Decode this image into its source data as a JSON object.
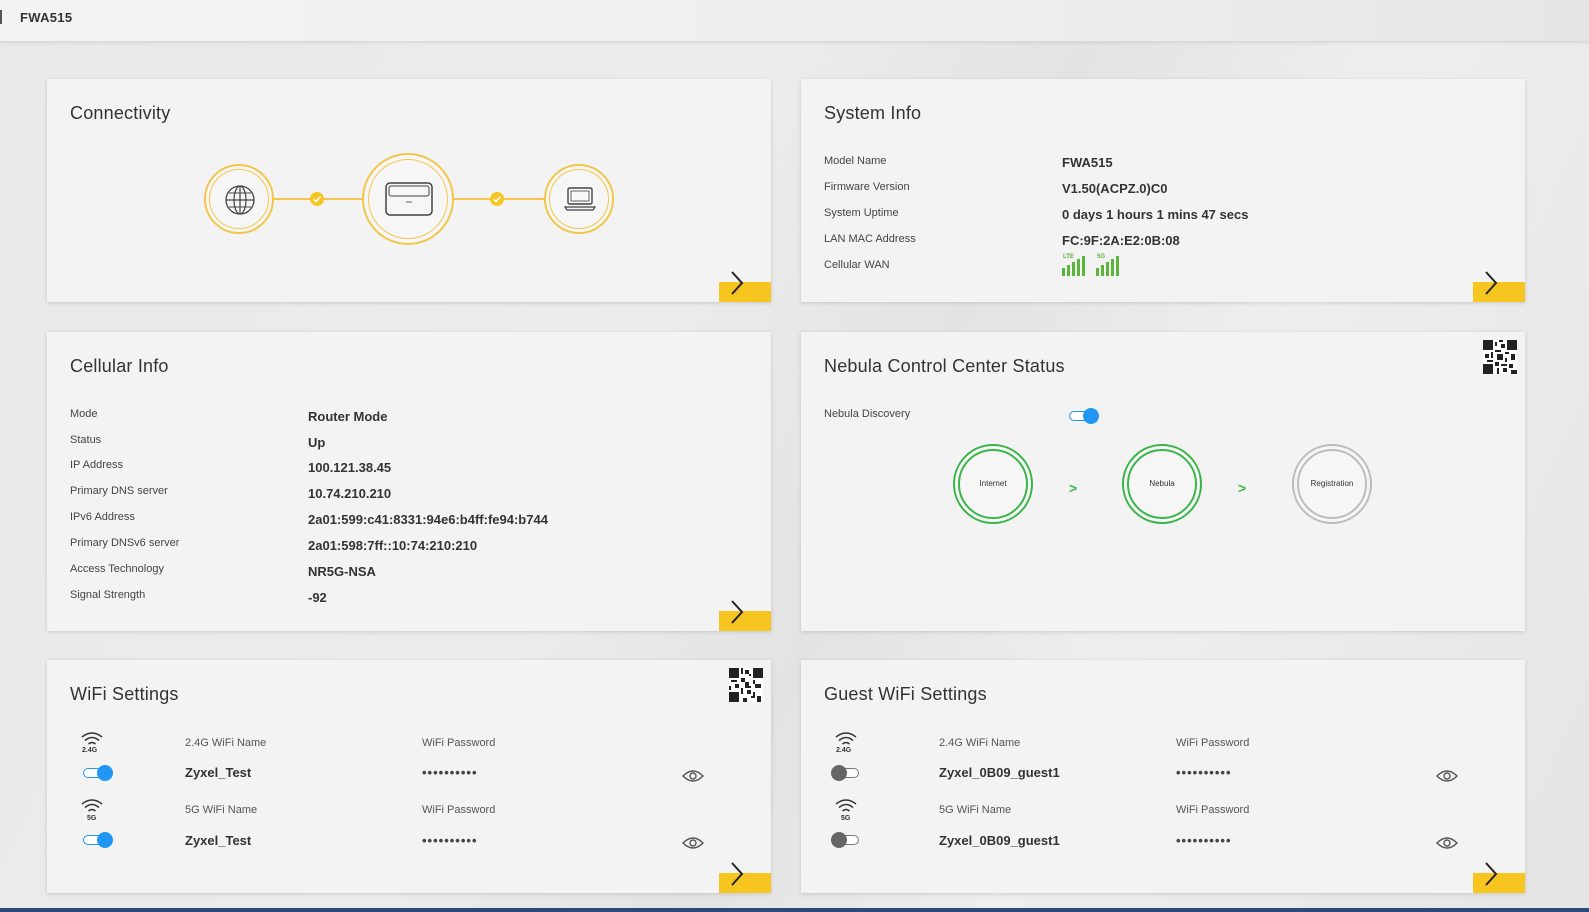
{
  "topbar": {
    "title": "FWA515"
  },
  "connectivity": {
    "title": "Connectivity",
    "icons": [
      "globe-icon",
      "router-icon",
      "laptop-icon"
    ],
    "accent": "#f6c520"
  },
  "system_info": {
    "title": "System Info",
    "rows": [
      {
        "label": "Model Name",
        "value": "FWA515"
      },
      {
        "label": "Firmware Version",
        "value": "V1.50(ACPZ.0)C0"
      },
      {
        "label": "System Uptime",
        "value": "0 days 1 hours 1 mins 47 secs"
      },
      {
        "label": "LAN MAC Address",
        "value": "FC:9F:2A:E2:0B:08"
      },
      {
        "label": "Cellular WAN",
        "value": ""
      }
    ],
    "cellular_wan": [
      {
        "tag": "LTE",
        "bars": 5
      },
      {
        "tag": "5G",
        "bars": 5
      }
    ]
  },
  "cellular_info": {
    "title": "Cellular Info",
    "rows": [
      {
        "label": "Mode",
        "value": "Router Mode"
      },
      {
        "label": "Status",
        "value": "Up"
      },
      {
        "label": "IP Address",
        "value": "100.121.38.45"
      },
      {
        "label": "Primary DNS server",
        "value": "10.74.210.210"
      },
      {
        "label": "IPv6 Address",
        "value": "2a01:599:c41:8331:94e6:b4ff:fe94:b744"
      },
      {
        "label": "Primary DNSv6 server",
        "value": "2a01:598:7ff::10:74:210:210"
      },
      {
        "label": "Access Technology",
        "value": "NR5G-NSA"
      },
      {
        "label": "Signal Strength",
        "value": "-92"
      }
    ]
  },
  "nebula": {
    "title": "Nebula Control Center Status",
    "discovery_label": "Nebula Discovery",
    "discovery_on": true,
    "steps": [
      {
        "label": "Internet",
        "status": "ok"
      },
      {
        "label": "Nebula",
        "status": "ok"
      },
      {
        "label": "Registration",
        "status": "pending"
      }
    ],
    "arrow": ">",
    "colors": {
      "ok": "#3bb54a",
      "pending": "#bdbdbd"
    }
  },
  "wifi": {
    "title": "WiFi Settings",
    "rows": [
      {
        "band": "2.4G",
        "name_label": "2.4G WiFi Name",
        "name": "Zyxel_Test",
        "pw_label": "WiFi Password",
        "pw": "••••••••••",
        "enabled": true
      },
      {
        "band": "5G",
        "name_label": "5G WiFi Name",
        "name": "Zyxel_Test",
        "pw_label": "WiFi Password",
        "pw": "••••••••••",
        "enabled": true
      }
    ]
  },
  "guest_wifi": {
    "title": "Guest WiFi Settings",
    "rows": [
      {
        "band": "2.4G",
        "name_label": "2.4G WiFi Name",
        "name": "Zyxel_0B09_guest1",
        "pw_label": "WiFi Password",
        "pw": "••••••••••",
        "enabled": false
      },
      {
        "band": "5G",
        "name_label": "5G WiFi Name",
        "name": "Zyxel_0B09_guest1",
        "pw_label": "WiFi Password",
        "pw": "••••••••••",
        "enabled": false
      }
    ]
  },
  "colors": {
    "accent": "#f6c520",
    "toggle_on": "#2196f3",
    "signal": "#5ab53a"
  }
}
